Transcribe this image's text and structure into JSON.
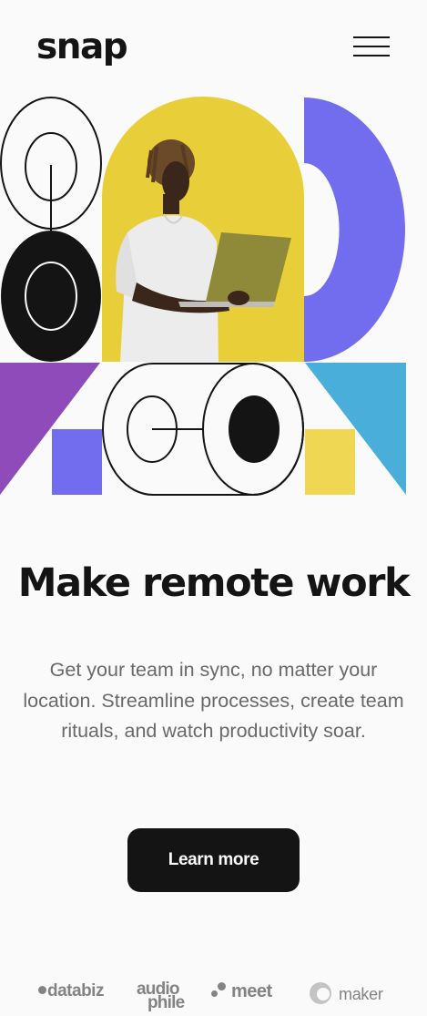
{
  "header": {
    "logo": "snap",
    "menu_icon": "hamburger-menu-icon"
  },
  "hero": {
    "illustration": "geometric-shapes-with-person-holding-laptop",
    "colors": {
      "yellow": "#E8CF3A",
      "purple": "#726CEE",
      "violet": "#8E4BB9",
      "blue": "#4AAEDB",
      "yellow_square": "#EFD653",
      "black": "#141414"
    }
  },
  "main": {
    "headline": "Make remote work",
    "description": "Get your team in sync, no matter your location. Streamline processes, create team rituals, and watch productivity soar.",
    "cta_label": "Learn more"
  },
  "clients": {
    "databiz": "databiz",
    "audiophile_line1": "audio",
    "audiophile_line2": "phile",
    "meet": "meet",
    "maker": "maker"
  },
  "colors": {
    "background": "#FAFAFA",
    "text_dark": "#141414",
    "text_gray": "#696969",
    "logo_gray": "#838383"
  }
}
